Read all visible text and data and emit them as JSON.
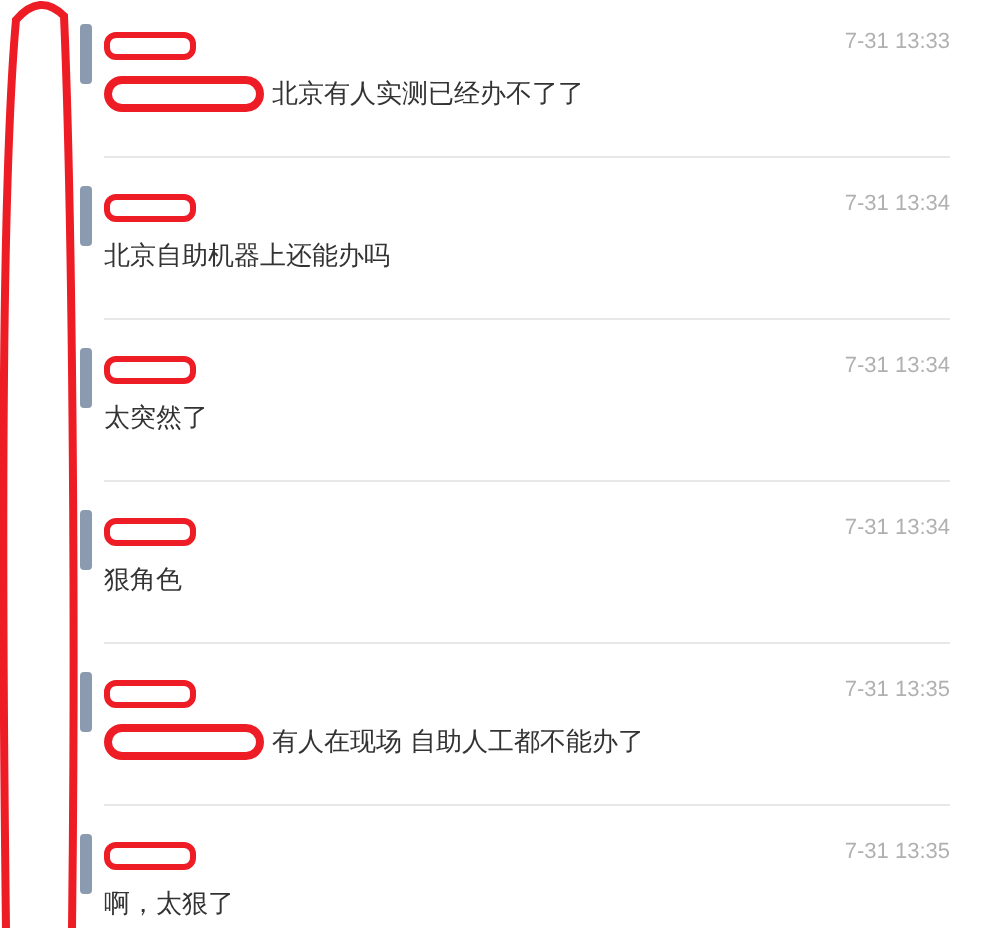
{
  "comments": [
    {
      "time": "7-31 13:33",
      "message": "北京有人实测已经办不了了",
      "prefix_hidden": true
    },
    {
      "time": "7-31 13:34",
      "message": "北京自助机器上还能办吗",
      "prefix_hidden": false
    },
    {
      "time": "7-31 13:34",
      "message": "太突然了",
      "prefix_hidden": false
    },
    {
      "time": "7-31 13:34",
      "message": "狠角色",
      "prefix_hidden": false
    },
    {
      "time": "7-31 13:35",
      "message": "有人在现场 自助人工都不能办了",
      "prefix_hidden": true
    },
    {
      "time": "7-31 13:35",
      "message": "啊，太狠了",
      "prefix_hidden": false
    }
  ]
}
